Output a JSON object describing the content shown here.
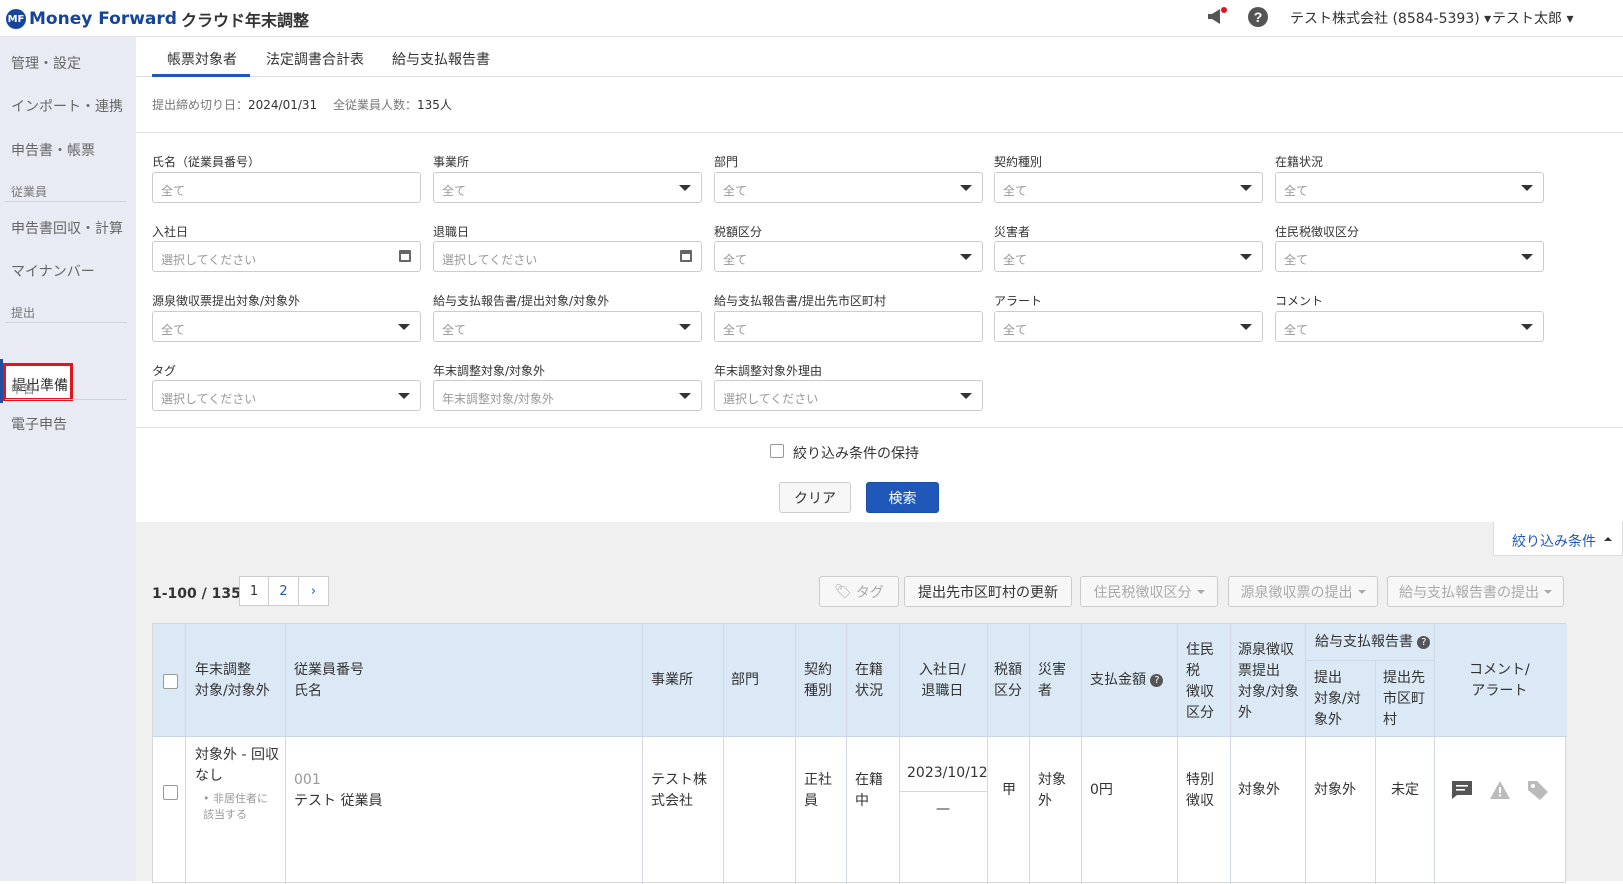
{
  "header": {
    "brand": "Money Forward",
    "product": "クラウド年末調整",
    "company": "テスト株式会社 (8584-5393)",
    "user": "テスト太郎"
  },
  "sidebar": {
    "items": {
      "admin": "管理・設定",
      "import": "インポート・連携",
      "forms": "申告書・帳票",
      "employee_head": "従業員",
      "collect": "申告書回収・計算",
      "mynumber": "マイナンバー",
      "submit_head": "提出",
      "prep": "提出準備",
      "declare_head": "申告",
      "edeclare": "電子申告"
    }
  },
  "tabs": [
    "帳票対象者",
    "法定調書合計表",
    "給与支払報告書"
  ],
  "info": {
    "deadline_label": "提出締め切り日：",
    "deadline": "2024/01/31",
    "count_label": "全従業員人数：",
    "count": "135人"
  },
  "filters": [
    {
      "label": "氏名（従業員番号）",
      "value": "全て"
    },
    {
      "label": "事業所",
      "value": "全て"
    },
    {
      "label": "部門",
      "value": "全て"
    },
    {
      "label": "契約種別",
      "value": "全て"
    },
    {
      "label": "在籍状況",
      "value": "全て"
    },
    {
      "label": "入社日",
      "value": "選択してください"
    },
    {
      "label": "退職日",
      "value": "選択してください"
    },
    {
      "label": "税額区分",
      "value": "全て"
    },
    {
      "label": "災害者",
      "value": "全て"
    },
    {
      "label": "住民税徴収区分",
      "value": "全て"
    },
    {
      "label": "源泉徴収票提出対象/対象外",
      "value": "全て"
    },
    {
      "label": "給与支払報告書/提出対象/対象外",
      "value": "全て"
    },
    {
      "label": "給与支払報告書/提出先市区町村",
      "value": "全て"
    },
    {
      "label": "アラート",
      "value": "全て"
    },
    {
      "label": "コメント",
      "value": "全て"
    },
    {
      "label": "タグ",
      "value": "選択してください"
    },
    {
      "label": "年末調整対象/対象外",
      "value": "年末調整対象/対象外"
    },
    {
      "label": "年末調整対象外理由",
      "value": "選択してください"
    }
  ],
  "keep_filter_label": "絞り込み条件の保持",
  "buttons": {
    "clear": "クリア",
    "search": "検索",
    "filter_toggle": "絞り込み条件"
  },
  "list": {
    "range": "1-100 / 135件",
    "pages": [
      "1",
      "2"
    ],
    "next": "›",
    "tag": "タグ",
    "update_city": "提出先市区町村の更新",
    "resident_tax": "住民税徴収区分",
    "withholding": "源泉徴収票の提出",
    "salary_report": "給与支払報告書の提出"
  },
  "table": {
    "headers": {
      "target": "年末調整\n対象/対象外",
      "emp": "従業員番号\n氏名",
      "office": "事業所",
      "dept": "部門",
      "contract": "契約\n種別",
      "status": "在籍\n状況",
      "dates": "入社日/\n退職日",
      "tax": "税額\n区分",
      "disaster": "災害\n者",
      "pay": "支払金額",
      "resident": "住民\n税\n徴収\n区分",
      "wh": "源泉徴収\n票提出\n対象/対象\n外",
      "salary_group": "給与支払報告書",
      "sr_target": "提出\n対象/対\n象外",
      "sr_city": "提出先\n市区町\n村",
      "comment": "コメント/\nアラート"
    },
    "rows": [
      {
        "target": "対象外 - 回収\nなし",
        "note": "非居住者に\n該当する",
        "emp_no": "001",
        "name": "テスト 従業員",
        "office": "テスト株\n式会社",
        "dept": "",
        "contract": "正社\n員",
        "status": "在籍\n中",
        "hire": "2023/10/12",
        "leave": "—",
        "tax": "甲",
        "disaster": "対象\n外",
        "pay": "0円",
        "resident": "特別\n徴収",
        "wh": "対象外",
        "sr_target": "対象外",
        "sr_city": "未定"
      }
    ]
  }
}
